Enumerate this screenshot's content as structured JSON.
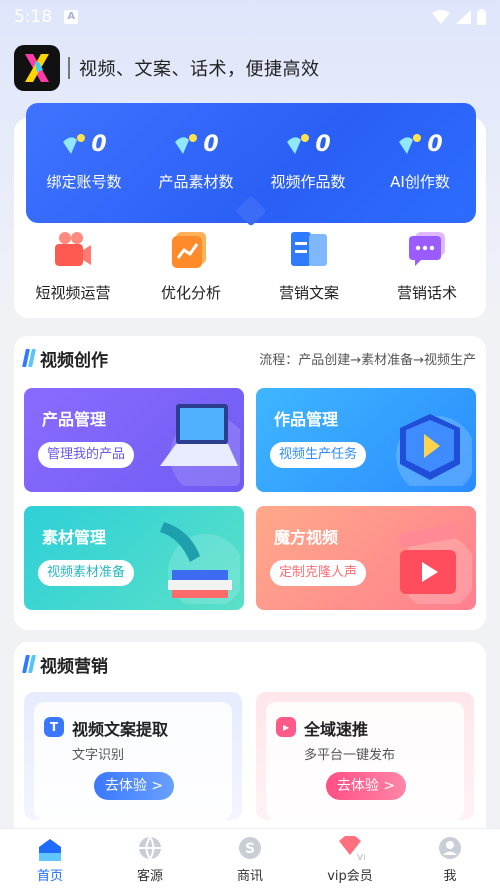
{
  "status_bar": {
    "time": "5:18",
    "notif_letter": "A"
  },
  "header": {
    "slogan": "视频、文案、话术，便捷高效"
  },
  "stats": [
    {
      "value": "0",
      "label": "绑定账号数"
    },
    {
      "value": "0",
      "label": "产品素材数"
    },
    {
      "value": "0",
      "label": "视频作品数"
    },
    {
      "value": "0",
      "label": "AI创作数"
    }
  ],
  "quick_actions": [
    {
      "label": "短视频运营",
      "icon": "video-camera-icon"
    },
    {
      "label": "优化分析",
      "icon": "chart-icon"
    },
    {
      "label": "营销文案",
      "icon": "book-icon"
    },
    {
      "label": "营销话术",
      "icon": "chat-icon"
    }
  ],
  "video_creation": {
    "title": "视频创作",
    "flow": "流程：产品创建→素材准备→视频生产",
    "tiles": [
      {
        "title": "产品管理",
        "pill": "管理我的产品"
      },
      {
        "title": "作品管理",
        "pill": "视频生产任务"
      },
      {
        "title": "素材管理",
        "pill": "视频素材准备"
      },
      {
        "title": "魔方视频",
        "pill": "定制克隆人声"
      }
    ]
  },
  "video_marketing": {
    "title": "视频营销",
    "cards": [
      {
        "title": "视频文案提取",
        "sub": "文字识别",
        "button": "去体验 >",
        "icon_letter": "T"
      },
      {
        "title": "全域速推",
        "sub": "多平台一键发布",
        "button": "去体验 >",
        "icon_letter": "▸"
      }
    ]
  },
  "tabs": [
    {
      "label": "首页",
      "icon": "home-icon",
      "active": true
    },
    {
      "label": "客源",
      "icon": "globe-icon"
    },
    {
      "label": "商讯",
      "icon": "dollar-icon"
    },
    {
      "label": "vip会员",
      "icon": "vip-diamond-icon"
    },
    {
      "label": "我",
      "icon": "user-icon"
    }
  ],
  "colors": {
    "brand_blue": "#2a5ff5",
    "tab_active": "#1f6bff"
  }
}
